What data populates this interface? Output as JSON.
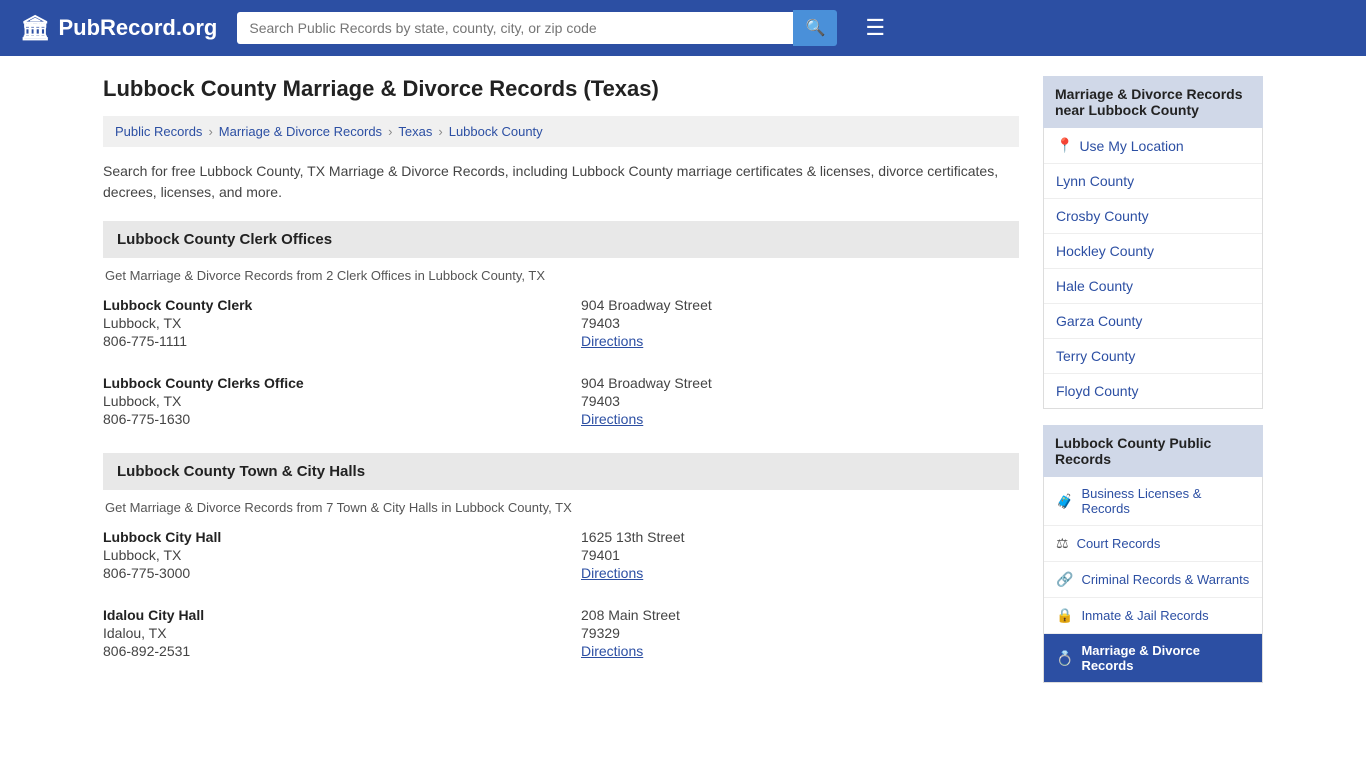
{
  "header": {
    "logo_text": "PubRecord.org",
    "logo_icon": "🏛",
    "search_placeholder": "Search Public Records by state, county, city, or zip code",
    "hamburger_label": "☰"
  },
  "page": {
    "title": "Lubbock County Marriage & Divorce Records (Texas)",
    "description": "Search for free Lubbock County, TX Marriage & Divorce Records, including Lubbock County marriage certificates & licenses, divorce certificates, decrees, licenses, and more."
  },
  "breadcrumb": {
    "items": [
      {
        "label": "Public Records",
        "href": "#"
      },
      {
        "label": "Marriage & Divorce Records",
        "href": "#"
      },
      {
        "label": "Texas",
        "href": "#"
      },
      {
        "label": "Lubbock County",
        "href": "#"
      }
    ]
  },
  "clerk_section": {
    "header": "Lubbock County Clerk Offices",
    "description": "Get Marriage & Divorce Records from 2 Clerk Offices in Lubbock County, TX",
    "offices": [
      {
        "name": "Lubbock County Clerk",
        "city_state": "Lubbock, TX",
        "phone": "806-775-1111",
        "address": "904 Broadway Street",
        "zip": "79403",
        "directions_label": "Directions"
      },
      {
        "name": "Lubbock County Clerks Office",
        "city_state": "Lubbock, TX",
        "phone": "806-775-1630",
        "address": "904 Broadway Street",
        "zip": "79403",
        "directions_label": "Directions"
      }
    ]
  },
  "cityhall_section": {
    "header": "Lubbock County Town & City Halls",
    "description": "Get Marriage & Divorce Records from 7 Town & City Halls in Lubbock County, TX",
    "offices": [
      {
        "name": "Lubbock City Hall",
        "city_state": "Lubbock, TX",
        "phone": "806-775-3000",
        "address": "1625 13th Street",
        "zip": "79401",
        "directions_label": "Directions"
      },
      {
        "name": "Idalou City Hall",
        "city_state": "Idalou, TX",
        "phone": "806-892-2531",
        "address": "208 Main Street",
        "zip": "79329",
        "directions_label": "Directions"
      }
    ]
  },
  "sidebar": {
    "nearby_header": "Marriage & Divorce Records near Lubbock County",
    "use_location_label": "Use My Location",
    "nearby_counties": [
      {
        "label": "Lynn County",
        "href": "#"
      },
      {
        "label": "Crosby County",
        "href": "#"
      },
      {
        "label": "Hockley County",
        "href": "#"
      },
      {
        "label": "Hale County",
        "href": "#"
      },
      {
        "label": "Garza County",
        "href": "#"
      },
      {
        "label": "Terry County",
        "href": "#"
      },
      {
        "label": "Floyd County",
        "href": "#"
      }
    ],
    "public_records_header": "Lubbock County Public Records",
    "public_records": [
      {
        "label": "Business Licenses & Records",
        "icon": "🧳",
        "href": "#",
        "active": false
      },
      {
        "label": "Court Records",
        "icon": "⚖",
        "href": "#",
        "active": false
      },
      {
        "label": "Criminal Records & Warrants",
        "icon": "🔗",
        "href": "#",
        "active": false
      },
      {
        "label": "Inmate & Jail Records",
        "icon": "🔒",
        "href": "#",
        "active": false
      },
      {
        "label": "Marriage & Divorce Records",
        "icon": "💍",
        "href": "#",
        "active": true
      }
    ]
  }
}
